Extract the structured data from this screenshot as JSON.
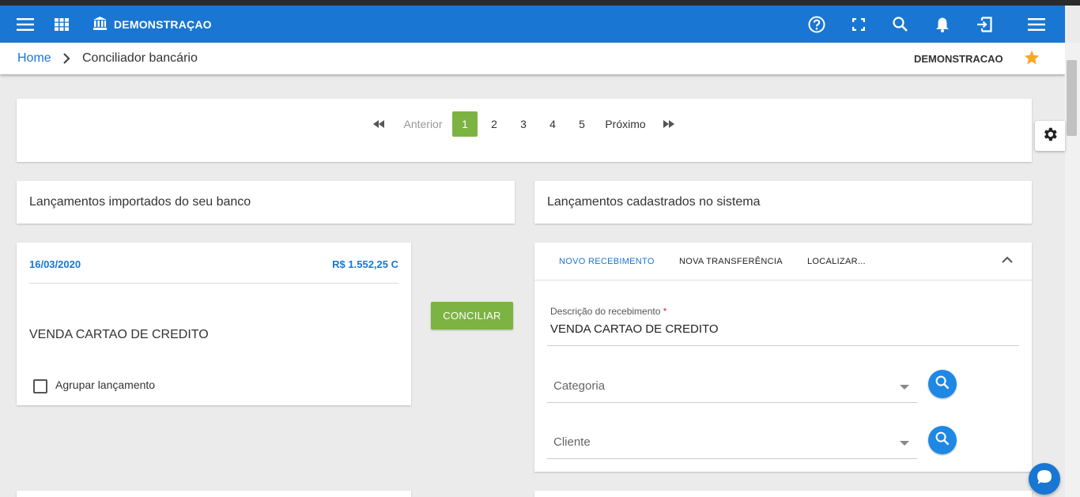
{
  "topbar": {
    "brand": "DEMONSTRAÇAO",
    "icons": [
      "menu-icon",
      "apps-grid-icon",
      "bank-icon",
      "help-icon",
      "fullscreen-icon",
      "search-icon",
      "notifications-icon",
      "exit-icon",
      "menu-icon"
    ]
  },
  "breadcrumb": {
    "home": "Home",
    "current": "Conciliador bancário",
    "company": "DEMONSTRACAO"
  },
  "pagination": {
    "previous": "Anterior",
    "next": "Próximo",
    "pages": [
      "1",
      "2",
      "3",
      "4",
      "5"
    ],
    "active_page": "1"
  },
  "left_panel": {
    "title": "Lançamentos importados do seu banco",
    "entry": {
      "date": "16/03/2020",
      "amount": "R$ 1.552,25 C",
      "description": "VENDA CARTAO DE CREDITO",
      "group_label": "Agrupar lançamento"
    }
  },
  "conciliar_button": "CONCILIAR",
  "right_panel": {
    "title": "Lançamentos cadastrados no sistema",
    "tabs": [
      "NOVO RECEBIMENTO",
      "NOVA TRANSFERÊNCIA",
      "LOCALIZAR..."
    ],
    "active_tab": "NOVO RECEBIMENTO",
    "form": {
      "description_label": "Descrição do recebimento",
      "required_mark": "*",
      "description_value": "VENDA CARTAO DE CREDITO",
      "category_placeholder": "Categoria",
      "client_placeholder": "Cliente"
    }
  },
  "colors": {
    "primary": "#1976d2",
    "accent_green": "#7cb342",
    "star": "#f9a825"
  }
}
